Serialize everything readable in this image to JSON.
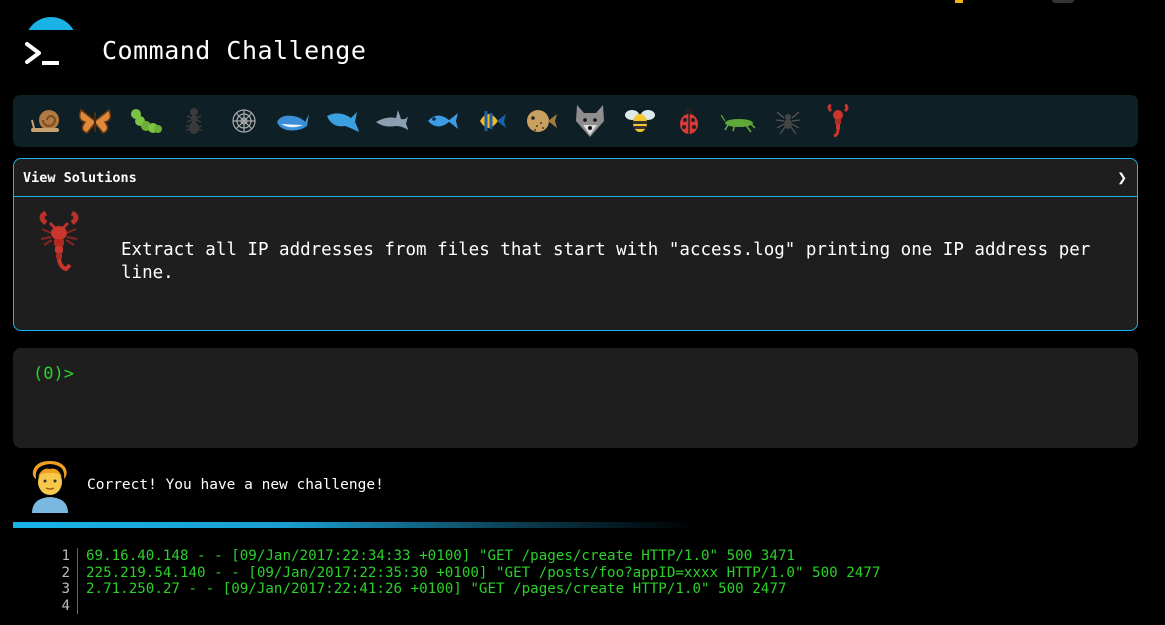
{
  "header": {
    "title": "Command Challenge"
  },
  "animals": [
    {
      "name": "snail",
      "icon": "snail-icon",
      "color": "#c68a4a"
    },
    {
      "name": "butterfly",
      "icon": "butterfly-icon",
      "color": "#e08a3c"
    },
    {
      "name": "caterpillar",
      "icon": "caterpillar-icon",
      "color": "#7cc243"
    },
    {
      "name": "ant",
      "icon": "ant-icon",
      "color": "#333333"
    },
    {
      "name": "spider-web",
      "icon": "spider-web-icon",
      "color": "#aaaaaa"
    },
    {
      "name": "whale",
      "icon": "whale-icon",
      "color": "#3c8fd6"
    },
    {
      "name": "dolphin",
      "icon": "dolphin-icon",
      "color": "#3aa0e0"
    },
    {
      "name": "shark",
      "icon": "shark-icon",
      "color": "#8aa0b0"
    },
    {
      "name": "fish",
      "icon": "fish-icon",
      "color": "#3d9be3"
    },
    {
      "name": "tropical-fish",
      "icon": "tropical-fish-icon",
      "color": "#f2b824"
    },
    {
      "name": "blowfish",
      "icon": "blowfish-icon",
      "color": "#c8a060"
    },
    {
      "name": "wolf",
      "icon": "wolf-icon",
      "color": "#8e8e8e"
    },
    {
      "name": "bee",
      "icon": "bee-icon",
      "color": "#f3c62b"
    },
    {
      "name": "ladybug",
      "icon": "ladybug-icon",
      "color": "#d83a3a"
    },
    {
      "name": "cricket",
      "icon": "cricket-icon",
      "color": "#5fa83a"
    },
    {
      "name": "spider",
      "icon": "spider-icon",
      "color": "#555555"
    },
    {
      "name": "scorpion",
      "icon": "scorpion-icon",
      "color": "#c8362e"
    }
  ],
  "solutions": {
    "title": "View Solutions",
    "challenge": "Extract all IP addresses from files that start with \"access.log\" printing one IP address per line."
  },
  "terminal": {
    "prompt": "(0)>"
  },
  "feedback": {
    "message": "Correct! You have a new challenge!"
  },
  "file_view": {
    "lines": [
      {
        "num": "1",
        "text": "69.16.40.148 - - [09/Jan/2017:22:34:33 +0100] \"GET /pages/create HTTP/1.0\" 500 3471"
      },
      {
        "num": "2",
        "text": "225.219.54.140 - - [09/Jan/2017:22:35:30 +0100] \"GET /posts/foo?appID=xxxx HTTP/1.0\" 500 2477"
      },
      {
        "num": "3",
        "text": "2.71.250.27 - - [09/Jan/2017:22:41:26 +0100] \"GET /pages/create HTTP/1.0\" 500 2477"
      },
      {
        "num": "4",
        "text": ""
      }
    ]
  },
  "colors": {
    "accent": "#1ab3e8",
    "terminal_green": "#2bd02b",
    "panel": "#1e1e1e",
    "animal_bar": "#0e1f26"
  }
}
